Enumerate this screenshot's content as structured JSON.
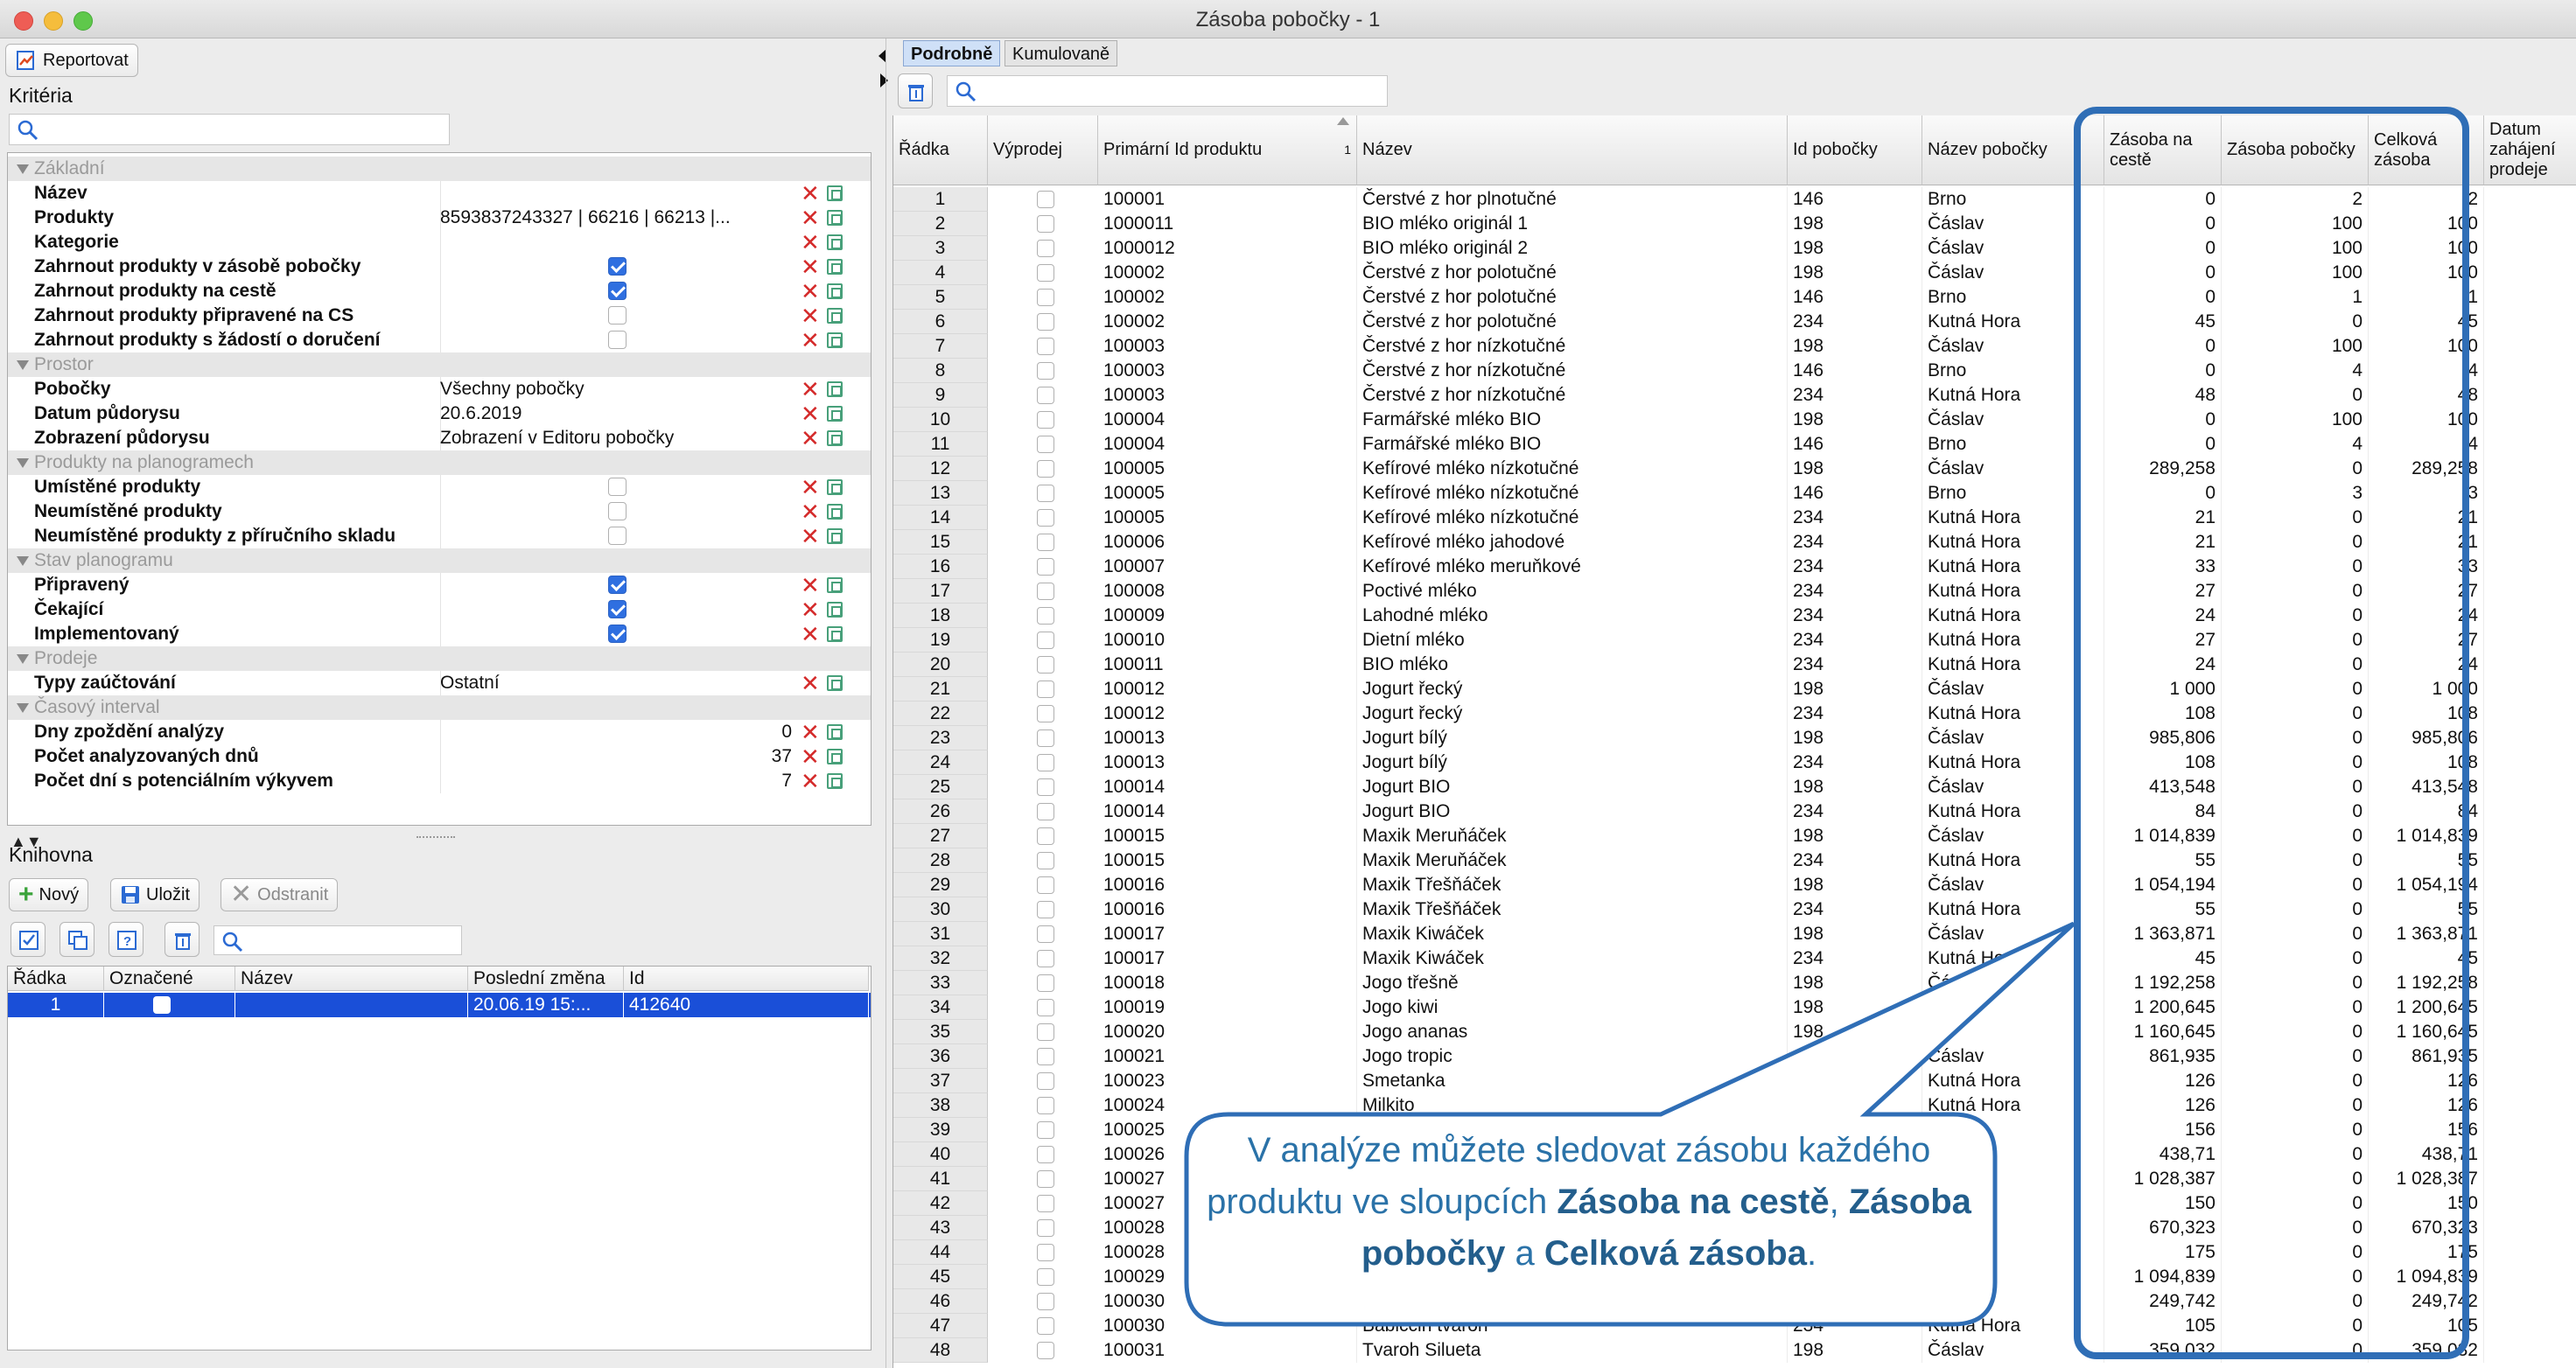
{
  "window": {
    "title": "Zásoba pobočky - 1"
  },
  "toolbar": {
    "report_label": "Reportovat"
  },
  "criteria": {
    "section_title": "Kritéria",
    "rows": [
      {
        "type": "group",
        "label": "Základní"
      },
      {
        "label": "Název"
      },
      {
        "label": "Produkty",
        "value": "8593837243327 | 66216 | 66213 |..."
      },
      {
        "label": "Kategorie"
      },
      {
        "label": "Zahrnout produkty v zásobě pobočky",
        "checked": true
      },
      {
        "label": "Zahrnout produkty na cestě",
        "checked": true
      },
      {
        "label": "Zahrnout produkty připravené na CS",
        "checked": false
      },
      {
        "label": "Zahrnout produkty s žádostí o doručení",
        "checked": false
      },
      {
        "type": "group",
        "label": "Prostor"
      },
      {
        "label": "Pobočky",
        "value": "Všechny pobočky"
      },
      {
        "label": "Datum půdorysu",
        "value": "20.6.2019"
      },
      {
        "label": "Zobrazení půdorysu",
        "value": "Zobrazení v Editoru pobočky"
      },
      {
        "type": "group",
        "label": "Produkty na planogramech"
      },
      {
        "label": "Umístěné produkty",
        "checked": false
      },
      {
        "label": "Neumístěné produkty",
        "checked": false
      },
      {
        "label": "Neumístěné produkty z příručního skladu",
        "checked": false
      },
      {
        "type": "group",
        "label": "Stav planogramu"
      },
      {
        "label": "Připravený",
        "checked": true
      },
      {
        "label": "Čekající",
        "checked": true
      },
      {
        "label": "Implementovaný",
        "checked": true
      },
      {
        "type": "group",
        "label": "Prodeje"
      },
      {
        "label": "Typy zaúčtování",
        "value": "Ostatní"
      },
      {
        "type": "group",
        "label": "Časový interval"
      },
      {
        "label": "Dny zpoždění analýzy",
        "value": "0",
        "align": "right"
      },
      {
        "label": "Počet analyzovaných dnů",
        "value": "37",
        "align": "right"
      },
      {
        "label": "Počet dní s potenciálním výkyvem",
        "value": "7",
        "align": "right"
      }
    ]
  },
  "library": {
    "section_title": "Knihovna",
    "new_label": "Nový",
    "save_label": "Uložit",
    "delete_label": "Odstranit",
    "columns": [
      "Řádka",
      "Označené",
      "Název",
      "Poslední změna",
      "Id"
    ],
    "rows": [
      {
        "radka": "1",
        "nazev": "",
        "zmena": "20.06.19 15:...",
        "id": "412640"
      }
    ]
  },
  "tabs": [
    "Podrobně",
    "Kumulovaně"
  ],
  "grid": {
    "columns": [
      "Řádka",
      "Výprodej",
      "Primární Id produktu",
      "Název",
      "Id pobočky",
      "Název pobočky",
      "Zásoba na cestě",
      "Zásoba pobočky",
      "Celková zásoba",
      "Datum zahájení prodeje"
    ],
    "sort_index": "1",
    "rows": [
      [
        "1",
        "100001",
        "Čerstvé z hor plnotučné",
        "146",
        "Brno",
        "0",
        "2",
        "2"
      ],
      [
        "2",
        "1000011",
        "BIO mléko originál 1",
        "198",
        "Čáslav",
        "0",
        "100",
        "100"
      ],
      [
        "3",
        "1000012",
        "BIO mléko originál 2",
        "198",
        "Čáslav",
        "0",
        "100",
        "100"
      ],
      [
        "4",
        "100002",
        "Čerstvé z hor polotučné",
        "198",
        "Čáslav",
        "0",
        "100",
        "100"
      ],
      [
        "5",
        "100002",
        "Čerstvé z hor polotučné",
        "146",
        "Brno",
        "0",
        "1",
        "1"
      ],
      [
        "6",
        "100002",
        "Čerstvé z hor polotučné",
        "234",
        "Kutná Hora",
        "45",
        "0",
        "45"
      ],
      [
        "7",
        "100003",
        "Čerstvé z hor nízkotučné",
        "198",
        "Čáslav",
        "0",
        "100",
        "100"
      ],
      [
        "8",
        "100003",
        "Čerstvé z hor nízkotučné",
        "146",
        "Brno",
        "0",
        "4",
        "4"
      ],
      [
        "9",
        "100003",
        "Čerstvé z hor nízkotučné",
        "234",
        "Kutná Hora",
        "48",
        "0",
        "48"
      ],
      [
        "10",
        "100004",
        "Farmářské mléko BIO",
        "198",
        "Čáslav",
        "0",
        "100",
        "100"
      ],
      [
        "11",
        "100004",
        "Farmářské mléko BIO",
        "146",
        "Brno",
        "0",
        "4",
        "4"
      ],
      [
        "12",
        "100005",
        "Kefírové mléko nízkotučné",
        "198",
        "Čáslav",
        "289,258",
        "0",
        "289,258"
      ],
      [
        "13",
        "100005",
        "Kefírové mléko nízkotučné",
        "146",
        "Brno",
        "0",
        "3",
        "3"
      ],
      [
        "14",
        "100005",
        "Kefírové mléko nízkotučné",
        "234",
        "Kutná Hora",
        "21",
        "0",
        "21"
      ],
      [
        "15",
        "100006",
        "Kefírové mléko jahodové",
        "234",
        "Kutná Hora",
        "21",
        "0",
        "21"
      ],
      [
        "16",
        "100007",
        "Kefírové mléko meruňkové",
        "234",
        "Kutná Hora",
        "33",
        "0",
        "33"
      ],
      [
        "17",
        "100008",
        "Poctivé mléko",
        "234",
        "Kutná Hora",
        "27",
        "0",
        "27"
      ],
      [
        "18",
        "100009",
        "Lahodné mléko",
        "234",
        "Kutná Hora",
        "24",
        "0",
        "24"
      ],
      [
        "19",
        "100010",
        "Dietní mléko",
        "234",
        "Kutná Hora",
        "27",
        "0",
        "27"
      ],
      [
        "20",
        "100011",
        "BIO mléko",
        "234",
        "Kutná Hora",
        "24",
        "0",
        "24"
      ],
      [
        "21",
        "100012",
        "Jogurt řecký",
        "198",
        "Čáslav",
        "1 000",
        "0",
        "1 000"
      ],
      [
        "22",
        "100012",
        "Jogurt řecký",
        "234",
        "Kutná Hora",
        "108",
        "0",
        "108"
      ],
      [
        "23",
        "100013",
        "Jogurt bílý",
        "198",
        "Čáslav",
        "985,806",
        "0",
        "985,806"
      ],
      [
        "24",
        "100013",
        "Jogurt bílý",
        "234",
        "Kutná Hora",
        "108",
        "0",
        "108"
      ],
      [
        "25",
        "100014",
        "Jogurt BIO",
        "198",
        "Čáslav",
        "413,548",
        "0",
        "413,548"
      ],
      [
        "26",
        "100014",
        "Jogurt BIO",
        "234",
        "Kutná Hora",
        "84",
        "0",
        "84"
      ],
      [
        "27",
        "100015",
        "Maxik Meruňáček",
        "198",
        "Čáslav",
        "1 014,839",
        "0",
        "1 014,839"
      ],
      [
        "28",
        "100015",
        "Maxik Meruňáček",
        "234",
        "Kutná Hora",
        "55",
        "0",
        "55"
      ],
      [
        "29",
        "100016",
        "Maxik Třešňáček",
        "198",
        "Čáslav",
        "1 054,194",
        "0",
        "1 054,194"
      ],
      [
        "30",
        "100016",
        "Maxik Třešňáček",
        "234",
        "Kutná Hora",
        "55",
        "0",
        "55"
      ],
      [
        "31",
        "100017",
        "Maxik Kiwáček",
        "198",
        "Čáslav",
        "1 363,871",
        "0",
        "1 363,871"
      ],
      [
        "32",
        "100017",
        "Maxik Kiwáček",
        "234",
        "Kutná Hora",
        "45",
        "0",
        "45"
      ],
      [
        "33",
        "100018",
        "Jogo třešně",
        "198",
        "Čáslav",
        "1 192,258",
        "0",
        "1 192,258"
      ],
      [
        "34",
        "100019",
        "Jogo kiwi",
        "198",
        "",
        "1 200,645",
        "0",
        "1 200,645"
      ],
      [
        "35",
        "100020",
        "Jogo ananas",
        "198",
        "",
        "1 160,645",
        "0",
        "1 160,645"
      ],
      [
        "36",
        "100021",
        "Jogo tropic",
        "",
        "Čáslav",
        "861,935",
        "0",
        "861,935"
      ],
      [
        "37",
        "100023",
        "Smetanka",
        "",
        "Kutná Hora",
        "126",
        "0",
        "126"
      ],
      [
        "38",
        "100024",
        "Milkito",
        "",
        "Kutná Hora",
        "126",
        "0",
        "126"
      ],
      [
        "39",
        "100025",
        "",
        "",
        "",
        "156",
        "0",
        "156"
      ],
      [
        "40",
        "100026",
        "",
        "",
        "",
        "438,71",
        "0",
        "438,71"
      ],
      [
        "41",
        "100027",
        "",
        "",
        "",
        "1 028,387",
        "0",
        "1 028,387"
      ],
      [
        "42",
        "100027",
        "",
        "",
        "",
        "150",
        "0",
        "150"
      ],
      [
        "43",
        "100028",
        "",
        "",
        "",
        "670,323",
        "0",
        "670,323"
      ],
      [
        "44",
        "100028",
        "",
        "",
        "",
        "175",
        "0",
        "175"
      ],
      [
        "45",
        "100029",
        "",
        "",
        "",
        "1 094,839",
        "0",
        "1 094,839"
      ],
      [
        "46",
        "100030",
        "",
        "",
        "",
        "249,742",
        "0",
        "249,742"
      ],
      [
        "47",
        "100030",
        "Babiččin tvaroh",
        "234",
        "Kutná Hora",
        "105",
        "0",
        "105"
      ],
      [
        "48",
        "100031",
        "Tvaroh Silueta",
        "198",
        "Čáslav",
        "359,032",
        "0",
        "359,032"
      ]
    ]
  },
  "callout": {
    "part1": "V analýze můžete sledovat zásobu každého produktu ve sloupcích ",
    "bold1": "Zásoba na cestě",
    "part2": ", ",
    "bold2": "Zásoba pobočky",
    "part3": " a ",
    "bold3": "Celková zásoba",
    "part4": "."
  },
  "colors": {
    "accent": "#2f6fe0",
    "selection": "#1a4fd8",
    "highlight": "#2f6eb6",
    "callout_text": "#2a72a8"
  }
}
